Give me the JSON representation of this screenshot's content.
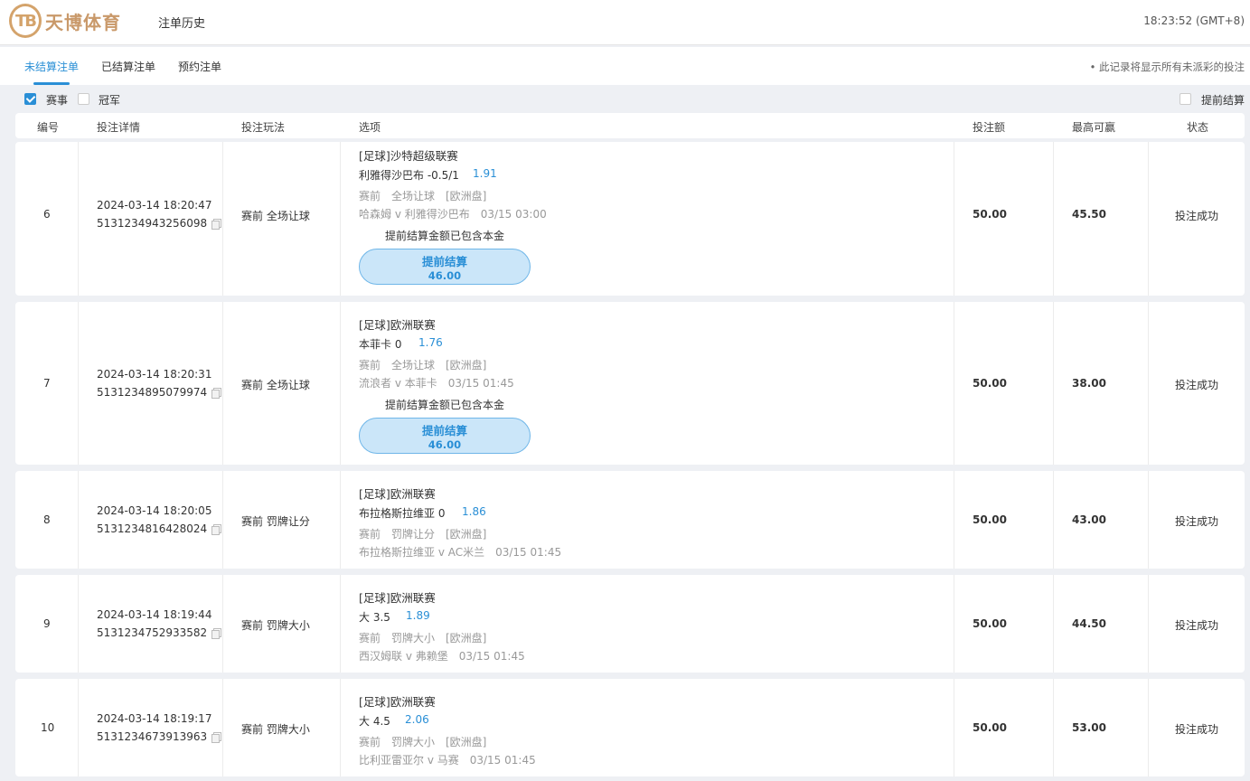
{
  "header": {
    "logo_text": "天博体育",
    "logo_mark": "TB",
    "title": "注单历史",
    "clock": "18:23:52 (GMT+8)"
  },
  "tabs": [
    {
      "label": "未结算注单"
    },
    {
      "label": "已结算注单"
    },
    {
      "label": "预约注单"
    }
  ],
  "note": "• 此记录将显示所有未派彩的投注",
  "filters": {
    "event": "赛事",
    "champion": "冠军",
    "early_settle": "提前结算"
  },
  "columns": {
    "no": "编号",
    "detail": "投注详情",
    "play": "投注玩法",
    "option": "选项",
    "stake": "投注额",
    "max_win": "最高可赢",
    "status": "状态"
  },
  "colors": {
    "accent": "#2a8fd6",
    "logo": "#d4a36b"
  },
  "rows": [
    {
      "no": "6",
      "time": "2024-03-14 18:20:47",
      "id": "5131234943256098",
      "play": "赛前 全场让球",
      "league": "[足球]沙特超级联赛",
      "pick": "利雅得沙巴布 -0.5/1",
      "odds": "1.91",
      "market": "赛前　全场让球　[欧洲盘]",
      "match": "哈森姆 v 利雅得沙巴布　03/15 03:00",
      "early_note": "提前结算金额已包含本金",
      "cashout_label": "提前结算",
      "cashout_value": "46.00",
      "stake": "50.00",
      "max_win": "45.50",
      "status": "投注成功"
    },
    {
      "no": "7",
      "time": "2024-03-14 18:20:31",
      "id": "5131234895079974",
      "play": "赛前 全场让球",
      "league": "[足球]欧洲联赛",
      "pick": "本菲卡 0",
      "odds": "1.76",
      "market": "赛前　全场让球　[欧洲盘]",
      "match": "流浪者 v 本菲卡　03/15 01:45",
      "early_note": "提前结算金额已包含本金",
      "cashout_label": "提前结算",
      "cashout_value": "46.00",
      "stake": "50.00",
      "max_win": "38.00",
      "status": "投注成功"
    },
    {
      "no": "8",
      "time": "2024-03-14 18:20:05",
      "id": "5131234816428024",
      "play": "赛前 罚牌让分",
      "league": "[足球]欧洲联赛",
      "pick": "布拉格斯拉维亚 0",
      "odds": "1.86",
      "market": "赛前　罚牌让分　[欧洲盘]",
      "match": "布拉格斯拉维亚 v AC米兰　03/15 01:45",
      "stake": "50.00",
      "max_win": "43.00",
      "status": "投注成功"
    },
    {
      "no": "9",
      "time": "2024-03-14 18:19:44",
      "id": "5131234752933582",
      "play": "赛前 罚牌大小",
      "league": "[足球]欧洲联赛",
      "pick": "大 3.5",
      "odds": "1.89",
      "market": "赛前　罚牌大小　[欧洲盘]",
      "match": "西汉姆联 v 弗赖堡　03/15 01:45",
      "stake": "50.00",
      "max_win": "44.50",
      "status": "投注成功"
    },
    {
      "no": "10",
      "time": "2024-03-14 18:19:17",
      "id": "5131234673913963",
      "play": "赛前 罚牌大小",
      "league": "[足球]欧洲联赛",
      "pick": "大 4.5",
      "odds": "2.06",
      "market": "赛前　罚牌大小　[欧洲盘]",
      "match": "比利亚雷亚尔 v 马赛　03/15 01:45",
      "stake": "50.00",
      "max_win": "53.00",
      "status": "投注成功"
    }
  ]
}
